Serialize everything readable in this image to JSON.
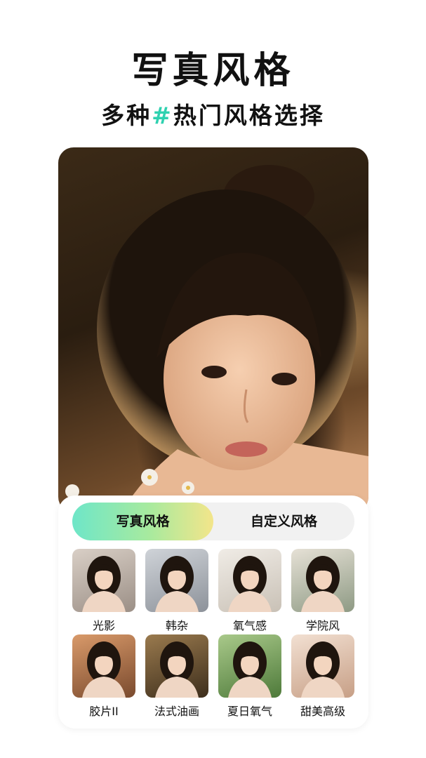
{
  "headline": {
    "title": "写真风格",
    "subtitle_prefix": "多种",
    "subtitle_hash": "#",
    "subtitle_rest": "热门风格选择"
  },
  "colors": {
    "accent": "#2fd1b0",
    "tab_gradient_start": "#6ee6c8",
    "tab_gradient_end": "#f3e58a"
  },
  "tabs": [
    {
      "label": "写真风格",
      "active": true
    },
    {
      "label": "自定义风格",
      "active": false
    }
  ],
  "styles": [
    {
      "label": "光影",
      "bg1": "#d9cfc6",
      "bg2": "#9b8f86"
    },
    {
      "label": "韩杂",
      "bg1": "#cfd3d8",
      "bg2": "#8d929a"
    },
    {
      "label": "氧气感",
      "bg1": "#f0ece6",
      "bg2": "#c9c1b6"
    },
    {
      "label": "学院风",
      "bg1": "#e6e1d6",
      "bg2": "#8e9a84"
    },
    {
      "label": "胶片II",
      "bg1": "#d99a6a",
      "bg2": "#7a4a2e"
    },
    {
      "label": "法式油画",
      "bg1": "#9a7a4e",
      "bg2": "#3d2e1c"
    },
    {
      "label": "夏日氧气",
      "bg1": "#a9c98a",
      "bg2": "#4e7a3a"
    },
    {
      "label": "甜美高级",
      "bg1": "#f2e0d2",
      "bg2": "#c79f86"
    }
  ]
}
